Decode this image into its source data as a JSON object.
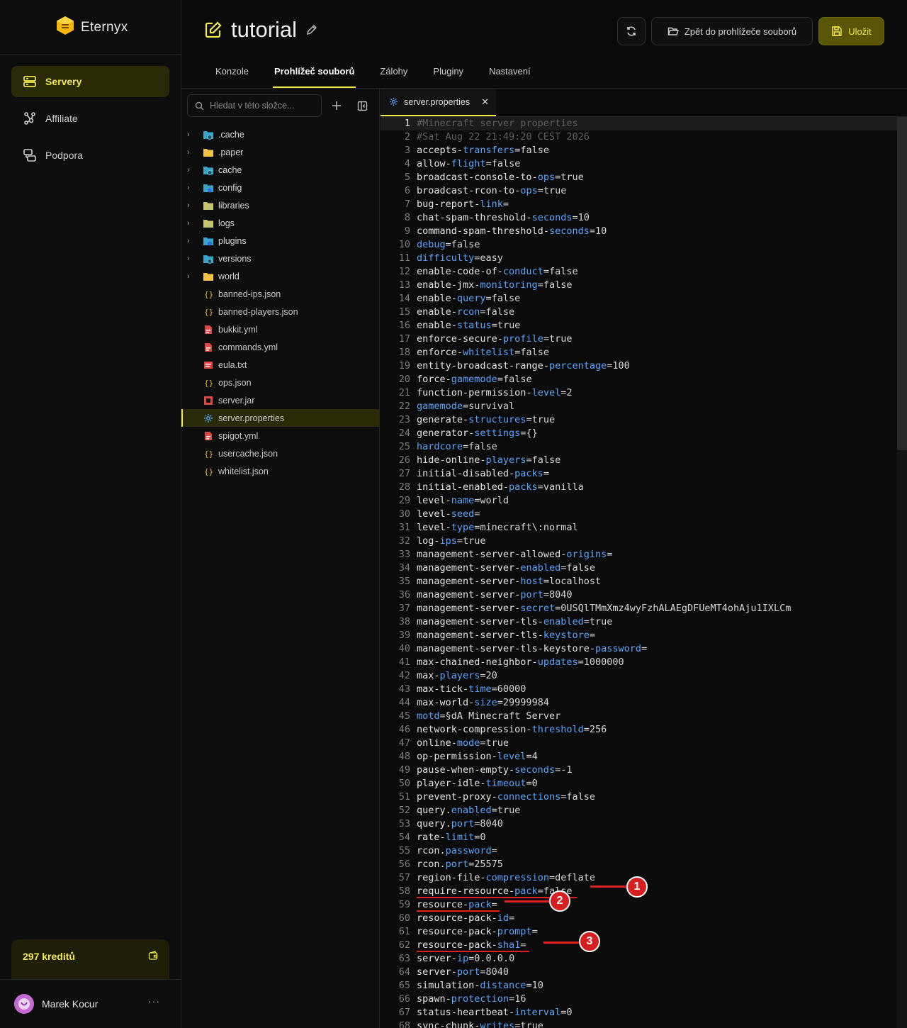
{
  "brand": {
    "name": "Eternyx",
    "accent": "#f2e94a"
  },
  "sidebar": {
    "items": [
      {
        "label": "Servery",
        "icon": "server-icon",
        "active": true
      },
      {
        "label": "Affiliate",
        "icon": "affiliate-icon",
        "active": false
      },
      {
        "label": "Podpora",
        "icon": "support-icon",
        "active": false
      }
    ],
    "credits": "297 kreditů",
    "user": {
      "name": "Marek Kocur",
      "more": "···"
    }
  },
  "header": {
    "title": "tutorial",
    "back_label": "Zpět do prohlížeče souborů",
    "save_label": "Uložit"
  },
  "tabs": [
    {
      "label": "Konzole",
      "active": false
    },
    {
      "label": "Prohlížeč souborů",
      "active": true
    },
    {
      "label": "Zálohy",
      "active": false
    },
    {
      "label": "Pluginy",
      "active": false
    },
    {
      "label": "Nastavení",
      "active": false
    }
  ],
  "filetree": {
    "search_placeholder": "Hledat v této složce...",
    "folders": [
      ".cache",
      ".paper",
      "cache",
      "config",
      "libraries",
      "logs",
      "plugins",
      "versions",
      "world"
    ],
    "files": [
      {
        "name": "banned-ips.json",
        "icon": "json-icon"
      },
      {
        "name": "banned-players.json",
        "icon": "json-icon"
      },
      {
        "name": "bukkit.yml",
        "icon": "yaml-icon"
      },
      {
        "name": "commands.yml",
        "icon": "yaml-icon"
      },
      {
        "name": "eula.txt",
        "icon": "text-icon"
      },
      {
        "name": "ops.json",
        "icon": "json-icon"
      },
      {
        "name": "server.jar",
        "icon": "jar-icon"
      },
      {
        "name": "server.properties",
        "icon": "gear-icon",
        "selected": true
      },
      {
        "name": "spigot.yml",
        "icon": "yaml-icon"
      },
      {
        "name": "usercache.json",
        "icon": "json-icon"
      },
      {
        "name": "whitelist.json",
        "icon": "json-icon"
      }
    ]
  },
  "editor": {
    "tab_label": "server.properties",
    "lines": [
      "#Minecraft server properties",
      "#Sat Aug 22 21:49:20 CEST 2026",
      "accepts-transfers=false",
      "allow-flight=false",
      "broadcast-console-to-ops=true",
      "broadcast-rcon-to-ops=true",
      "bug-report-link=",
      "chat-spam-threshold-seconds=10",
      "command-spam-threshold-seconds=10",
      "debug=false",
      "difficulty=easy",
      "enable-code-of-conduct=false",
      "enable-jmx-monitoring=false",
      "enable-query=false",
      "enable-rcon=false",
      "enable-status=true",
      "enforce-secure-profile=true",
      "enforce-whitelist=false",
      "entity-broadcast-range-percentage=100",
      "force-gamemode=false",
      "function-permission-level=2",
      "gamemode=survival",
      "generate-structures=true",
      "generator-settings={}",
      "hardcore=false",
      "hide-online-players=false",
      "initial-disabled-packs=",
      "initial-enabled-packs=vanilla",
      "level-name=world",
      "level-seed=",
      "level-type=minecraft\\:normal",
      "log-ips=true",
      "management-server-allowed-origins=",
      "management-server-enabled=false",
      "management-server-host=localhost",
      "management-server-port=8040",
      "management-server-secret=0USQlTMmXmz4wyFzhALAEgDFUeMT4ohAju1IXLCm",
      "management-server-tls-enabled=true",
      "management-server-tls-keystore=",
      "management-server-tls-keystore-password=",
      "max-chained-neighbor-updates=1000000",
      "max-players=20",
      "max-tick-time=60000",
      "max-world-size=29999984",
      "motd=§dA Minecraft Server",
      "network-compression-threshold=256",
      "online-mode=true",
      "op-permission-level=4",
      "pause-when-empty-seconds=-1",
      "player-idle-timeout=0",
      "prevent-proxy-connections=false",
      "query.enabled=true",
      "query.port=8040",
      "rate-limit=0",
      "rcon.password=",
      "rcon.port=25575",
      "region-file-compression=deflate",
      "require-resource-pack=false",
      "resource-pack=",
      "resource-pack-id=",
      "resource-pack-prompt=",
      "resource-pack-sha1=",
      "server-ip=0.0.0.0",
      "server-port=8040",
      "simulation-distance=10",
      "spawn-protection=16",
      "status-heartbeat-interval=0",
      "sync-chunk-writes=true"
    ]
  },
  "annotations": [
    {
      "label": "1",
      "line": 58
    },
    {
      "label": "2",
      "line": 59
    },
    {
      "label": "3",
      "line": 62
    }
  ]
}
